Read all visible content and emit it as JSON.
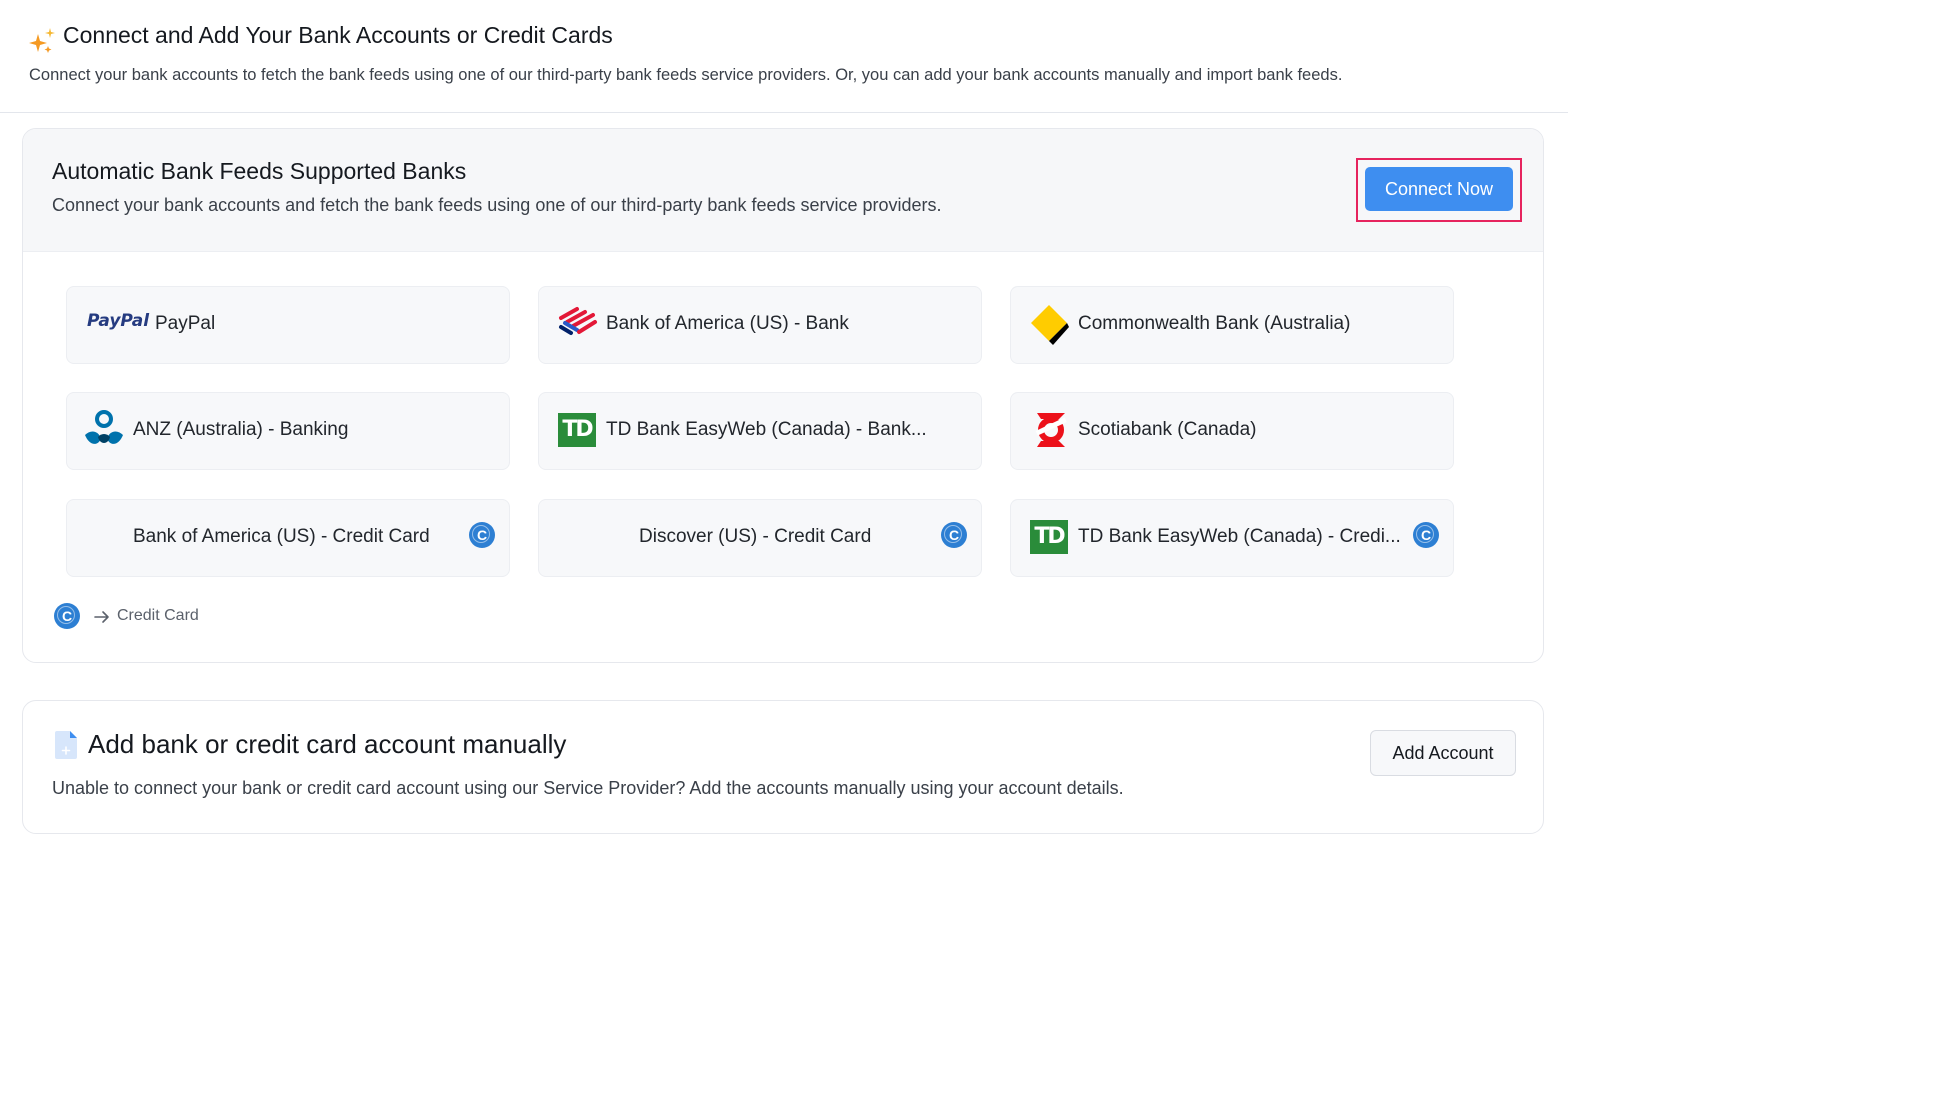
{
  "header": {
    "title": "Connect and Add Your Bank Accounts or Credit Cards",
    "subtitle": "Connect your bank accounts to fetch the bank feeds using one of our third-party bank feeds service providers. Or, you can add your bank accounts manually and import bank feeds."
  },
  "auto_feeds": {
    "title": "Automatic Bank Feeds Supported Banks",
    "subtitle": "Connect your bank accounts and fetch the bank feeds using one of our third-party bank feeds service providers.",
    "connect_label": "Connect Now",
    "banks": [
      {
        "label": "PayPal",
        "logo_text": "PayPal",
        "icon": "paypal-logo"
      },
      {
        "label": "Bank of America (US) - Bank",
        "icon": "bank-of-america-logo"
      },
      {
        "label": "Commonwealth Bank (Australia)",
        "icon": "commonwealth-bank-logo"
      },
      {
        "label": "ANZ (Australia) - Banking",
        "icon": "anz-logo"
      },
      {
        "label": "TD Bank EasyWeb (Canada) - Bank...",
        "logo_text": "TD",
        "icon": "td-logo"
      },
      {
        "label": "Scotiabank (Canada)",
        "icon": "scotiabank-logo"
      },
      {
        "label": "Bank of America (US) - Credit Card",
        "badge": "C"
      },
      {
        "label": "Discover (US) - Credit Card",
        "badge": "C"
      },
      {
        "label": "TD Bank EasyWeb (Canada) - Credi...",
        "logo_text": "TD",
        "icon": "td-logo",
        "badge": "C"
      }
    ],
    "legend": {
      "badge": "C",
      "label": "Credit Card"
    }
  },
  "manual": {
    "title": "Add bank or credit card account manually",
    "subtitle": "Unable to connect your bank or credit card account using our Service Provider? Add the accounts manually using your account details.",
    "add_label": "Add Account"
  },
  "colors": {
    "primary": "#3e8ef0",
    "highlight": "#e6245e",
    "badge": "#2d7fd3",
    "sparkle": "#f59a23"
  }
}
